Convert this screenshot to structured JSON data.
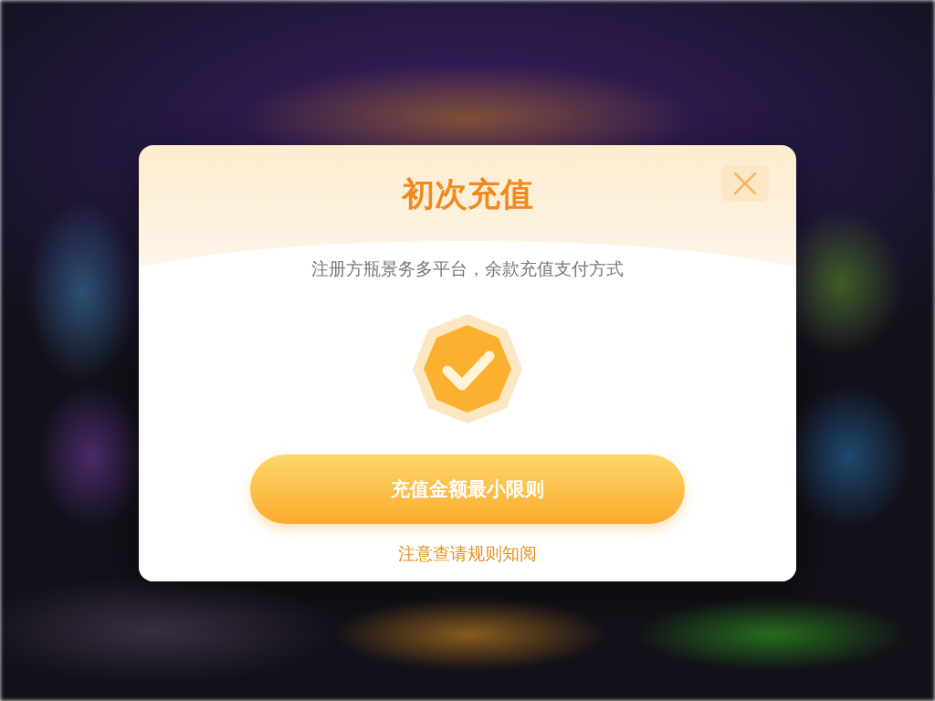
{
  "dialog": {
    "title": "初次充值",
    "message": "注册方瓶景务多平台，余款充值支付方式",
    "primary_button": "充值金额最小限则",
    "link": "注意查请规则知阅"
  }
}
